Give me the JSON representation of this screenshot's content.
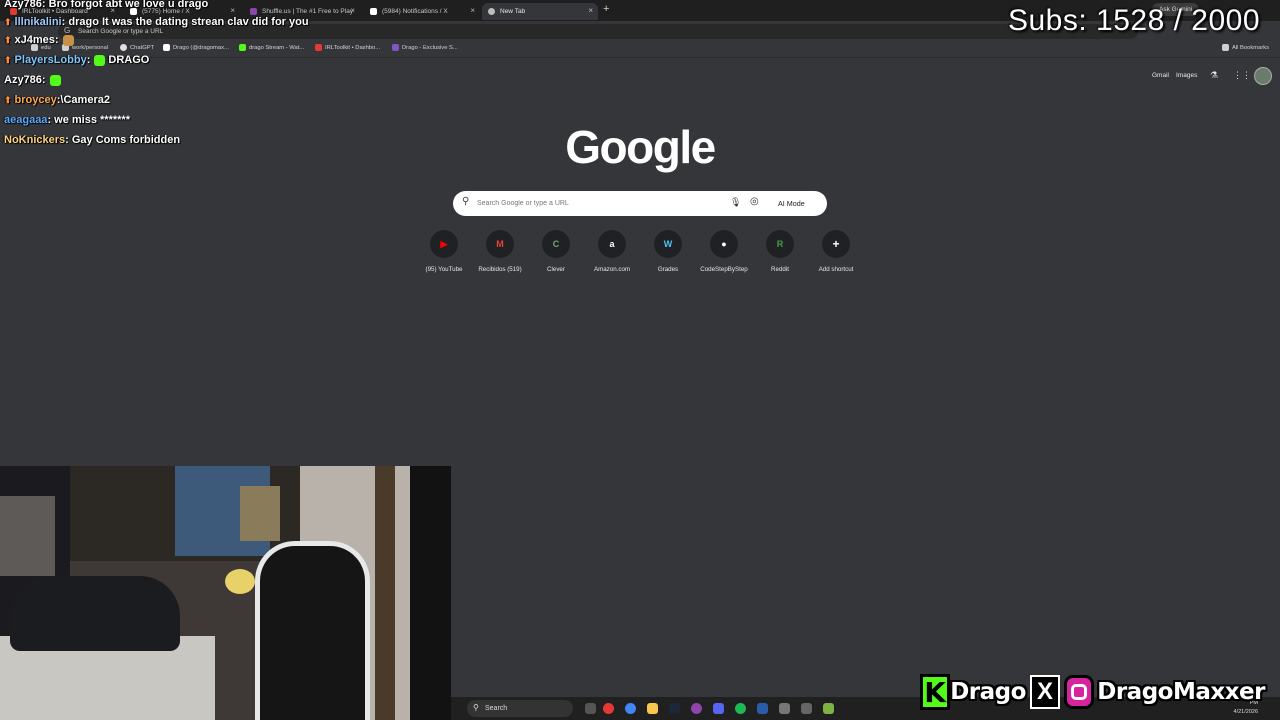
{
  "browser": {
    "tabs": [
      {
        "title": "IRLToolkit • Dashboard",
        "favicon_color": "#e53935",
        "active": false
      },
      {
        "title": "(5775) Home / X",
        "favicon_color": "#ffffff",
        "active": false
      },
      {
        "title": "Shuffle.us | The #1 Free to Play",
        "favicon_color": "#8e44ad",
        "active": false
      },
      {
        "title": "(5984) Notifications / X",
        "favicon_color": "#ffffff",
        "active": false
      },
      {
        "title": "New Tab",
        "favicon_color": "#bdbdbd",
        "active": true
      }
    ],
    "new_tab_symbol": "+",
    "ask_gemini": "Ask Gemini",
    "omnibox_text": "Search Google or type a URL",
    "bookmarks": [
      {
        "label": "edu",
        "icon": "folder-icon",
        "color": "#cfcfcf"
      },
      {
        "label": "work/personal",
        "icon": "folder-icon",
        "color": "#cfcfcf"
      },
      {
        "label": "ChatGPT",
        "icon": "chatgpt-icon",
        "color": "#e0e0e0"
      },
      {
        "label": "Drago (@dragomax...",
        "icon": "x-icon",
        "color": "#ffffff"
      },
      {
        "label": "drago Stream - Wat...",
        "icon": "kick-icon",
        "color": "#53fc18"
      },
      {
        "label": "IRLToolkit • Dashbo...",
        "icon": "irltoolkit-icon",
        "color": "#e53935"
      },
      {
        "label": "Drago - Exclusive S...",
        "icon": "exclusive-icon",
        "color": "#7e57c2"
      }
    ],
    "all_bookmarks": "All Bookmarks"
  },
  "google": {
    "links": [
      "Gmail",
      "Images"
    ],
    "logo_text": "Google",
    "search_placeholder": "Search Google or type a URL",
    "ai_mode_label": "AI Mode",
    "shortcuts": [
      {
        "label": "(95) YouTube",
        "glyph": "▶",
        "color": "#ff0000"
      },
      {
        "label": "Recibidos (519)",
        "glyph": "M",
        "color": "#ea4335"
      },
      {
        "label": "Clever",
        "glyph": "C",
        "color": "#6ba86b"
      },
      {
        "label": "Amazon.com",
        "glyph": "a",
        "color": "#ffffff"
      },
      {
        "label": "Grades",
        "glyph": "W",
        "color": "#4fc3f7"
      },
      {
        "label": "CodeStepByStep",
        "glyph": "●",
        "color": "#ffffff"
      },
      {
        "label": "Reddit",
        "glyph": "R",
        "color": "#43a047"
      },
      {
        "label": "Add shortcut",
        "glyph": "+",
        "color": "#ffffff"
      }
    ]
  },
  "chat": [
    {
      "user": "Azy786",
      "user_color": "#ffffff",
      "message": "Bro forgot abt we love u drago",
      "badge": false
    },
    {
      "user": "lllnikalini",
      "user_color": "#9ecbff",
      "message": "drago It was the dating strean clav did for you",
      "badge": true
    },
    {
      "user": "xJ4mes",
      "user_color": "#ffffff",
      "message": "",
      "badge": true,
      "emote_color": "#c8914a"
    },
    {
      "user": "PlayersLobby",
      "user_color": "#7ec8ff",
      "message": "DRAGO",
      "badge": true,
      "emote_color": "#53fc18"
    },
    {
      "user": "Azy786",
      "user_color": "#ffffff",
      "message": "",
      "badge": false,
      "emote_color": "#53fc18"
    },
    {
      "user": "broycey",
      "user_color": "#ffa94d",
      "message": "\\Camera2",
      "badge": true
    },
    {
      "user": "aeagaaa",
      "user_color": "#5aa9ff",
      "message": "we miss *******",
      "badge": false
    },
    {
      "user": "NoKnickers",
      "user_color": "#ffd27a",
      "message": "Gay Coms forbidden",
      "badge": false
    }
  ],
  "overlay": {
    "subs_text": "Subs: 1528 / 2000",
    "kick_name": "Drago",
    "handle": "DragoMaxxer"
  },
  "taskbar": {
    "search_label": "Search",
    "time": "PM",
    "date": "4/21/2026"
  }
}
